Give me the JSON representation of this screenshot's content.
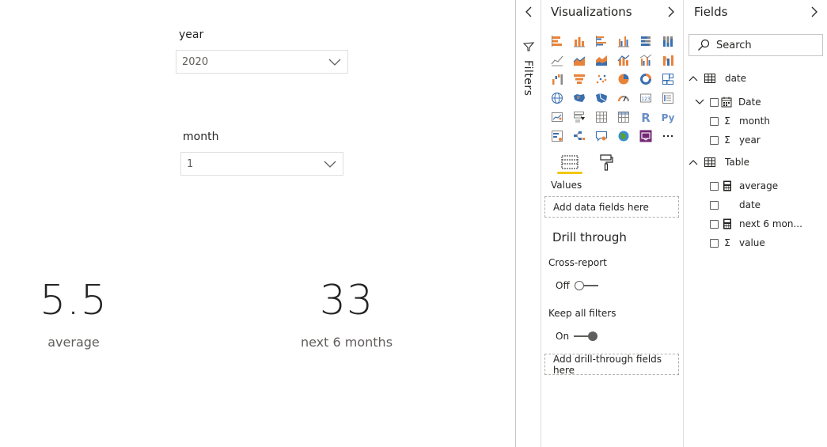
{
  "canvas": {
    "slicers": [
      {
        "title": "year",
        "value": "2020"
      },
      {
        "title": "month",
        "value": "1"
      }
    ],
    "cards": [
      {
        "value": "5.5",
        "label": "average"
      },
      {
        "value": "33",
        "label": "next 6 months"
      }
    ]
  },
  "filters_pane": {
    "label": "Filters"
  },
  "visualizations": {
    "title": "Visualizations",
    "icons": [
      "stacked-bar-chart-icon",
      "stacked-column-chart-icon",
      "clustered-bar-chart-icon",
      "clustered-column-chart-icon",
      "100-stacked-bar-chart-icon",
      "100-stacked-column-chart-icon",
      "line-chart-icon",
      "area-chart-icon",
      "stacked-area-chart-icon",
      "line-and-stacked-column-icon",
      "line-and-clustered-column-icon",
      "ribbon-chart-icon",
      "waterfall-chart-icon",
      "funnel-chart-icon",
      "scatter-chart-icon",
      "pie-chart-icon",
      "donut-chart-icon",
      "treemap-icon",
      "map-icon",
      "filled-map-icon",
      "shape-map-icon",
      "gauge-icon",
      "card-icon",
      "multi-row-card-icon",
      "kpi-icon",
      "slicer-icon",
      "table-icon",
      "matrix-icon",
      "r-visual-icon",
      "python-visual-icon",
      "key-influencers-icon",
      "decomposition-tree-icon",
      "qa-icon",
      "arcgis-map-icon",
      "power-apps-icon",
      "more-visuals-icon"
    ],
    "values_label": "Values",
    "values_placeholder": "Add data fields here",
    "drill_title": "Drill through",
    "cross_report_label": "Cross-report",
    "cross_report_state": "Off",
    "keep_filters_label": "Keep all filters",
    "keep_filters_state": "On",
    "drill_placeholder": "Add drill-through fields here"
  },
  "fields": {
    "title": "Fields",
    "search_placeholder": "Search",
    "tables": [
      {
        "name": "date",
        "items": [
          {
            "name": "Date",
            "type": "date-hierarchy"
          },
          {
            "name": "month",
            "type": "sigma"
          },
          {
            "name": "year",
            "type": "sigma"
          }
        ]
      },
      {
        "name": "Table",
        "items": [
          {
            "name": "average",
            "type": "measure"
          },
          {
            "name": "date",
            "type": "none"
          },
          {
            "name": "next 6 mon...",
            "type": "measure"
          },
          {
            "name": "value",
            "type": "sigma"
          }
        ]
      }
    ]
  },
  "colors": {
    "accent_yellow": "#f2c811",
    "chart_orange": "#e8833a",
    "chart_blue": "#3a6fb0",
    "text": "#252423",
    "muted": "#605e5c"
  }
}
